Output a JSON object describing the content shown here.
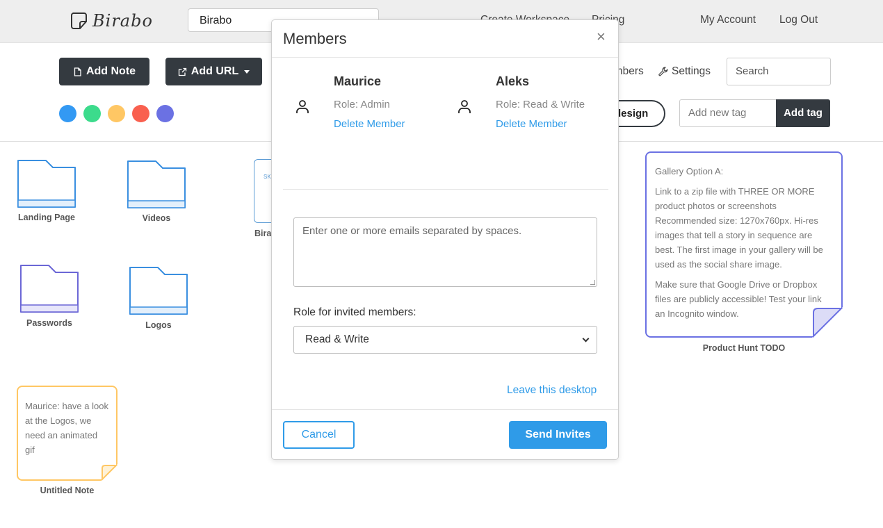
{
  "header": {
    "logo_text": "Birabo",
    "workspace_select": "Birabo",
    "nav": [
      "Create Workspace",
      "Pricing",
      "My Account",
      "Log Out"
    ]
  },
  "toolbar": {
    "add_note": "Add Note",
    "add_url": "Add URL",
    "colors": [
      "#3399f3",
      "#3cdb8c",
      "#ffc764",
      "#f9604f",
      "#6b71e3"
    ],
    "members_link": "nbers",
    "settings_link": "Settings",
    "search_placeholder": "Search",
    "design_button": "design",
    "tag_placeholder": "Add new tag",
    "add_tag": "Add tag"
  },
  "desktop": {
    "folders": [
      {
        "label": "Landing Page",
        "color": "#3a8fe0"
      },
      {
        "label": "Videos",
        "color": "#3a8fe0"
      },
      {
        "label": "Passwords",
        "color": "#6b67d6"
      },
      {
        "label": "Logos",
        "color": "#3a8fe0"
      }
    ],
    "doc": {
      "label": "Bira",
      "thumb_text": "SK"
    },
    "notes": [
      {
        "label": "Product Hunt TODO",
        "color": "#6b71e3",
        "lines": [
          "Gallery Option A:",
          "Link to a zip file with THREE OR MORE product photos or screenshots Recommended size: 1270x760px. Hi-res images that tell a story in sequence are best. The first image in your gallery will be used as the social share image.",
          "Make sure that Google Drive or Dropbox files are publicly accessible! Test your link an Incognito window."
        ]
      },
      {
        "label": "Untitled Note",
        "color": "#ffc764",
        "lines": [
          "Maurice: have a look at the Logos, we need an animated gif"
        ]
      }
    ]
  },
  "modal": {
    "title": "Members",
    "close": "×",
    "members": [
      {
        "name": "Maurice",
        "role": "Role: Admin",
        "delete": "Delete Member"
      },
      {
        "name": "Aleks",
        "role": "Role: Read & Write",
        "delete": "Delete Member"
      }
    ],
    "emails_placeholder": "Enter one or more emails separated by spaces.",
    "role_label": "Role for invited members:",
    "role_value": "Read & Write",
    "leave": "Leave this desktop",
    "cancel": "Cancel",
    "send": "Send Invites"
  }
}
